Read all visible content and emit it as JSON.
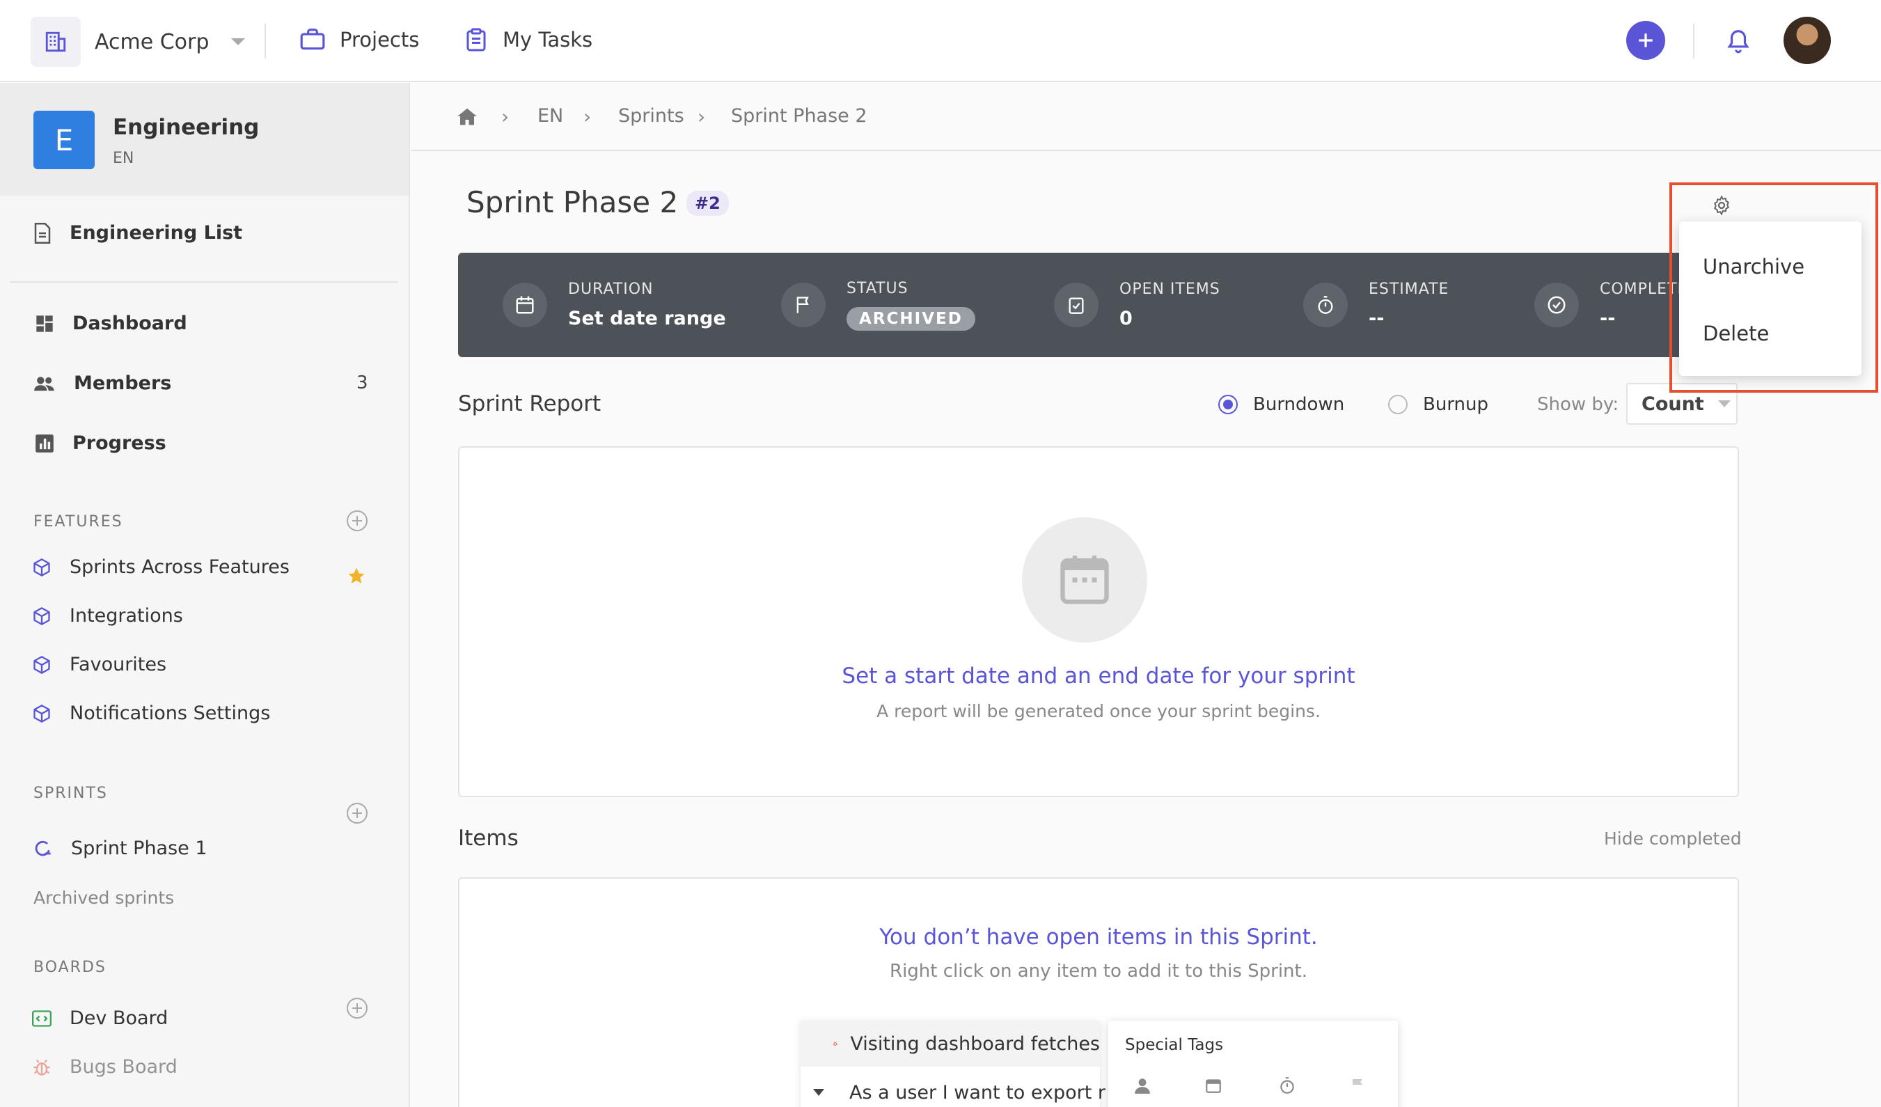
{
  "topbar": {
    "org_name": "Acme Corp",
    "projects_label": "Projects",
    "my_tasks_label": "My Tasks"
  },
  "sidebar": {
    "project_initial": "E",
    "project_name": "Engineering",
    "project_key": "EN",
    "list_label": "Engineering List",
    "nav": [
      {
        "label": "Dashboard"
      },
      {
        "label": "Members",
        "count": "3"
      },
      {
        "label": "Progress"
      }
    ],
    "features_title": "FEATURES",
    "features": [
      {
        "label": "Sprints Across Features"
      },
      {
        "label": "Integrations"
      },
      {
        "label": "Favourites"
      },
      {
        "label": "Notifications Settings"
      }
    ],
    "sprints_title": "SPRINTS",
    "sprint_item": "Sprint Phase 1",
    "archived_sprints": "Archived sprints",
    "boards_title": "BOARDS",
    "boards": [
      {
        "label": "Dev Board"
      },
      {
        "label": "Bugs Board"
      }
    ]
  },
  "breadcrumb": [
    "EN",
    "Sprints",
    "Sprint Phase 2"
  ],
  "sprint": {
    "title": "Sprint Phase 2",
    "number": "#2"
  },
  "stats": {
    "duration_label": "DURATION",
    "duration_value": "Set date range",
    "status_label": "STATUS",
    "status_value": "ARCHIVED",
    "open_label": "OPEN ITEMS",
    "open_value": "0",
    "estimate_label": "ESTIMATE",
    "estimate_value": "--",
    "complete_label": "COMPLETE",
    "complete_value": "--"
  },
  "report": {
    "title": "Sprint Report",
    "burndown": "Burndown",
    "burnup": "Burnup",
    "show_by_label": "Show by:",
    "show_by_value": "Count",
    "empty_title": "Set a start date and an end date for your sprint",
    "empty_sub": "A report will be generated once your sprint begins."
  },
  "items": {
    "title": "Items",
    "hide_completed": "Hide completed",
    "empty_title": "You don’t have open items in this Sprint.",
    "empty_sub": "Right click on any item to add it to this Sprint.",
    "preview_row1": "Visiting dashboard fetches",
    "preview_row2": "As a user I want to export r",
    "special_tags": "Special Tags"
  },
  "menu": {
    "unarchive": "Unarchive",
    "delete": "Delete"
  },
  "colors": {
    "accent": "#5a55d6",
    "stats_bg": "#4d5158",
    "highlight": "#e4502f"
  }
}
